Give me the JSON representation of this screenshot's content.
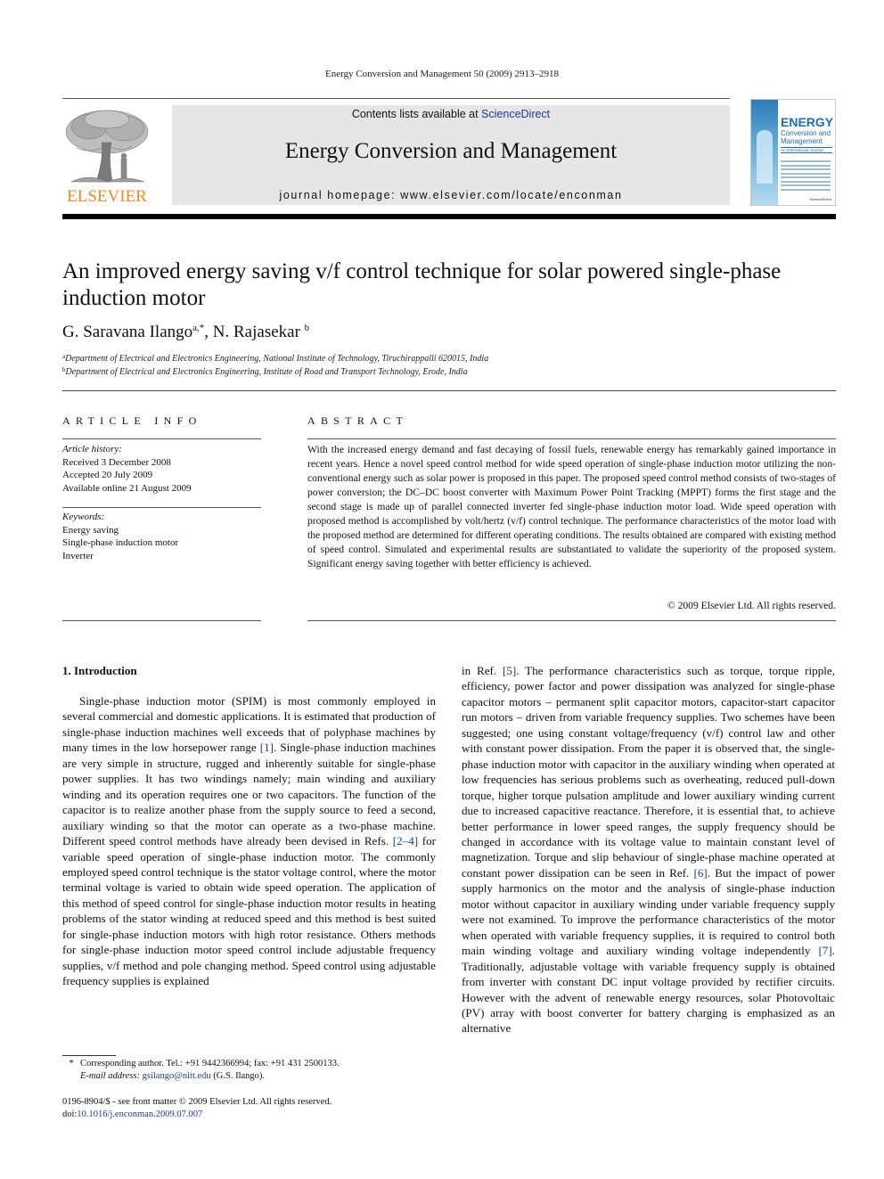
{
  "running_head": "Energy Conversion and Management 50 (2009) 2913–2918",
  "header": {
    "publisher_logo_text": "ELSEVIER",
    "contents_prefix": "Contents lists available at ",
    "contents_link": "ScienceDirect",
    "journal_title": "Energy Conversion and Management",
    "homepage": "journal homepage: www.elsevier.com/locate/enconman",
    "cover": {
      "title_big": "ENERGY",
      "title_sub": "Conversion and Management",
      "tagline": "An International Journal",
      "publisher": "ScienceDirect"
    }
  },
  "colors": {
    "elsevier_orange": "#f08a24",
    "link_blue": "#1d3c8f",
    "banner_gray": "#e6e6e6"
  },
  "article": {
    "title": "An improved energy saving v/f control technique for solar powered single-phase induction motor",
    "authors": [
      {
        "name": "G. Saravana Ilango",
        "marks": "a,*"
      },
      {
        "name": "N. Rajasekar",
        "marks": "b"
      }
    ],
    "author_separator": ", ",
    "affiliations": [
      {
        "mark": "a",
        "text": "Department of Electrical and Electronics Engineering, National Institute of Technology, Tiruchirappalli 620015, India"
      },
      {
        "mark": "b",
        "text": "Department of Electrical and Electronics Engineering, Institute of Road and Transport Technology, Erode, India"
      }
    ]
  },
  "article_info": {
    "heading": "ARTICLE INFO",
    "history_label": "Article history:",
    "history": [
      "Received 3 December 2008",
      "Accepted 20 July 2009",
      "Available online 21 August 2009"
    ],
    "keywords_label": "Keywords:",
    "keywords": [
      "Energy saving",
      "Single-phase induction motor",
      "Inverter"
    ]
  },
  "abstract": {
    "heading": "ABSTRACT",
    "text": "With the increased energy demand and fast decaying of fossil fuels, renewable energy has remarkably gained importance in recent years. Hence a novel speed control method for wide speed operation of single-phase induction motor utilizing the non-conventional energy such as solar power is proposed in this paper. The proposed speed control method consists of two-stages of power conversion; the DC–DC boost converter with Maximum Power Point Tracking (MPPT) forms the first stage and the second stage is made up of parallel connected inverter fed single-phase induction motor load. Wide speed operation with proposed method is accomplished by volt/hertz (v/f) control technique. The performance characteristics of the motor load with the proposed method are determined for different operating conditions. The results obtained are compared with existing method of speed control. Simulated and experimental results are substantiated to validate the superiority of the proposed system. Significant energy saving together with better efficiency is achieved.",
    "copyright": "© 2009 Elsevier Ltd. All rights reserved."
  },
  "body": {
    "section_heading": "1. Introduction",
    "left": [
      {
        "t": "Single-phase induction motor (SPIM) is most commonly employed in several commercial and domestic applications. It is estimated that production of single-phase induction machines well exceeds that of polyphase machines by many times in the low horsepower range "
      },
      {
        "ref": "[1]"
      },
      {
        "t": ". Single-phase induction machines are very simple in structure, rugged and inherently suitable for single-phase power supplies. It has two windings namely; main winding and auxiliary winding and its operation requires one or two capacitors. The function of the capacitor is to realize another phase from the supply source to feed a second, auxiliary winding so that the motor can operate as a two-phase machine. Different speed control methods have already been devised in Refs. "
      },
      {
        "ref": "[2–4]"
      },
      {
        "t": " for variable speed operation of single-phase induction motor. The commonly employed speed control technique is the stator voltage control, where the motor terminal voltage is varied to obtain wide speed operation. The application of this method of speed control for single-phase induction motor results in heating problems of the stator winding at reduced speed and this method is best suited for single-phase induction motors with high rotor resistance. Others methods for single-phase induction motor speed control include adjustable frequency supplies, v/f method and pole changing method. Speed control using adjustable frequency supplies is explained"
      }
    ],
    "right": [
      {
        "t": "in Ref. "
      },
      {
        "ref": "[5]"
      },
      {
        "t": ". The performance characteristics such as torque, torque ripple, efficiency, power factor and power dissipation was analyzed for single-phase capacitor motors – permanent split capacitor motors, capacitor-start capacitor run motors – driven from variable frequency supplies. Two schemes have been suggested; one using constant voltage/frequency (v/f) control law and other with constant power dissipation. From the paper it is observed that, the single-phase induction motor with capacitor in the auxiliary winding when operated at low frequencies has serious problems such as overheating, reduced pull-down torque, higher torque pulsation amplitude and lower auxiliary winding current due to increased capacitive reactance. Therefore, it is essential that, to achieve better performance in lower speed ranges, the supply frequency should be changed in accordance with its voltage value to maintain constant level of magnetization. Torque and slip behaviour of single-phase machine operated at constant power dissipation can be seen in Ref. "
      },
      {
        "ref": "[6]"
      },
      {
        "t": ". But the impact of power supply harmonics on the motor and the analysis of single-phase induction motor without capacitor in auxiliary winding under variable frequency supply were not examined. To improve the performance characteristics of the motor when operated with variable frequency supplies, it is required to control both main winding voltage and auxiliary winding voltage independently "
      },
      {
        "ref": "[7]"
      },
      {
        "t": ". Traditionally, adjustable voltage with variable frequency supply is obtained from inverter with constant DC input voltage provided by rectifier circuits. However with the advent of renewable energy resources, solar Photovoltaic (PV) array with boost converter for battery charging is emphasized as an alternative"
      }
    ]
  },
  "footnote": {
    "star": "*",
    "corresponding": "Corresponding author. Tel.: +91 9442366994; fax: +91 431 2500133.",
    "email_label": "E-mail address:",
    "email": "gsilango@nitt.edu",
    "email_suffix": " (G.S. Ilango).",
    "issn_line": "0196-8904/$ - see front matter © 2009 Elsevier Ltd. All rights reserved.",
    "doi_prefix": "doi:",
    "doi": "10.1016/j.enconman.2009.07.007"
  }
}
